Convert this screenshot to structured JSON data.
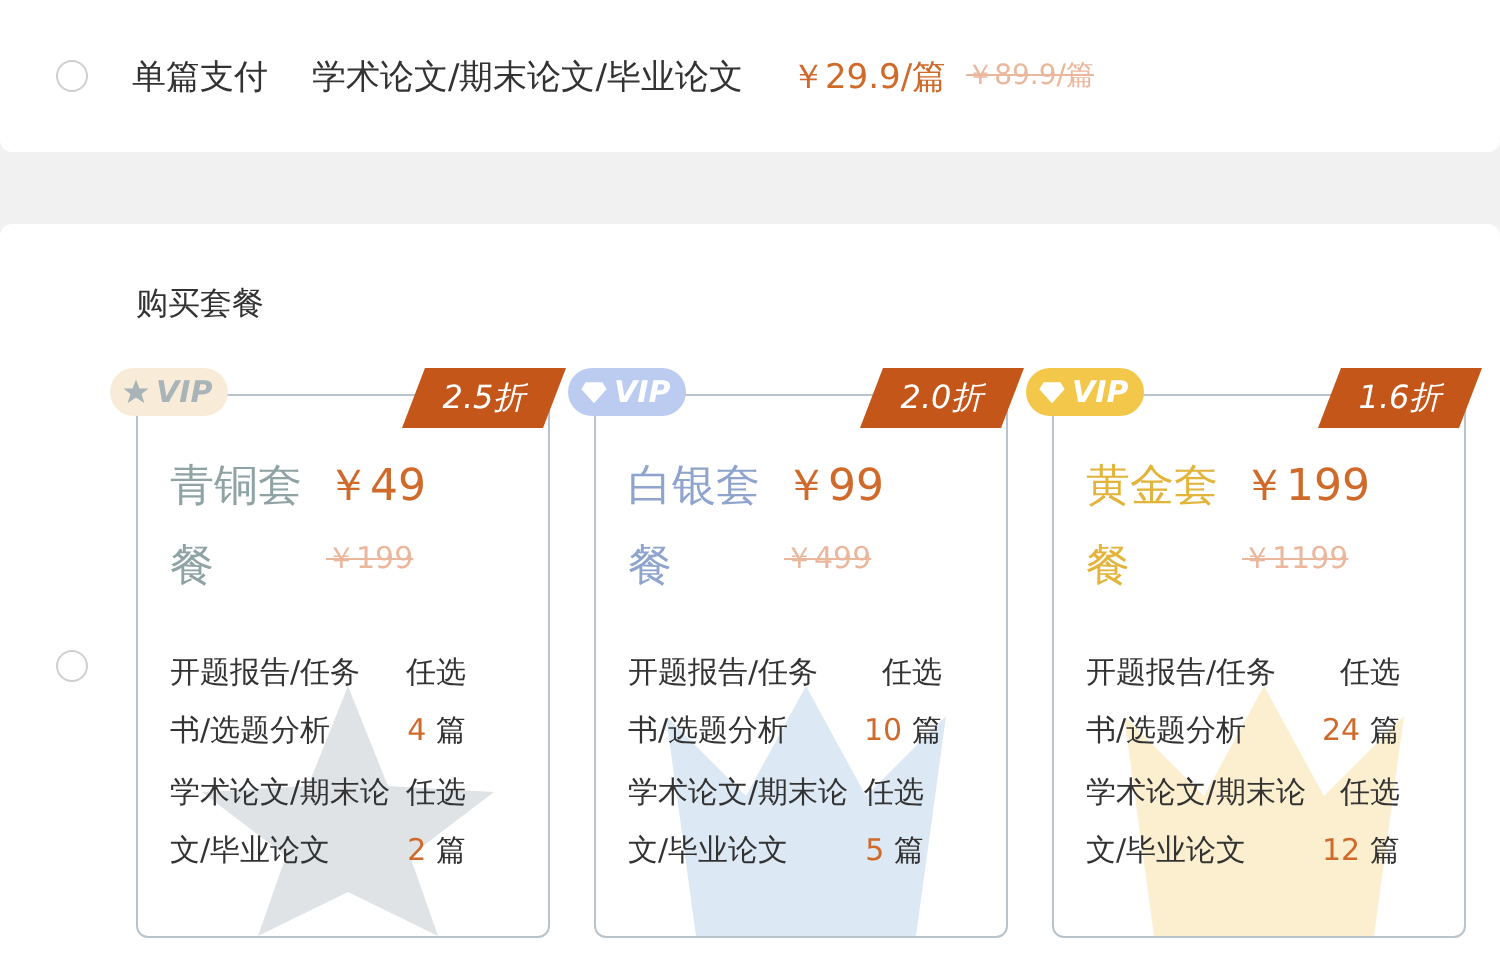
{
  "single": {
    "selected": false,
    "label": "单篇支付",
    "scope": "学术论文/期末论文/毕业论文",
    "price": "￥29.9/篇",
    "original_price": "￥89.9/篇"
  },
  "packages": {
    "title": "购买套餐",
    "selected": false,
    "items": [
      {
        "kind": "bronze",
        "badge": "VIP",
        "discount": "2.5折",
        "name": "青铜套餐",
        "price": "￥49",
        "original_price": "￥199",
        "features": [
          {
            "label": "开题报告/任务书/选题分析",
            "choice": "任选",
            "count": "4",
            "unit": "篇"
          },
          {
            "label": "学术论文/期末论文/毕业论文",
            "choice": "任选",
            "count": "2",
            "unit": "篇"
          }
        ]
      },
      {
        "kind": "silver",
        "badge": "VIP",
        "discount": "2.0折",
        "name": "白银套餐",
        "price": "￥99",
        "original_price": "￥499",
        "features": [
          {
            "label": "开题报告/任务书/选题分析",
            "choice": "任选",
            "count": "10",
            "unit": "篇"
          },
          {
            "label": "学术论文/期末论文/毕业论文",
            "choice": "任选",
            "count": "5",
            "unit": "篇"
          }
        ]
      },
      {
        "kind": "gold",
        "badge": "VIP",
        "discount": "1.6折",
        "name": "黄金套餐",
        "price": "￥199",
        "original_price": "￥1199",
        "features": [
          {
            "label": "开题报告/任务书/选题分析",
            "choice": "任选",
            "count": "24",
            "unit": "篇"
          },
          {
            "label": "学术论文/期末论文/毕业论文",
            "choice": "任选",
            "count": "12",
            "unit": "篇"
          }
        ]
      }
    ]
  }
}
